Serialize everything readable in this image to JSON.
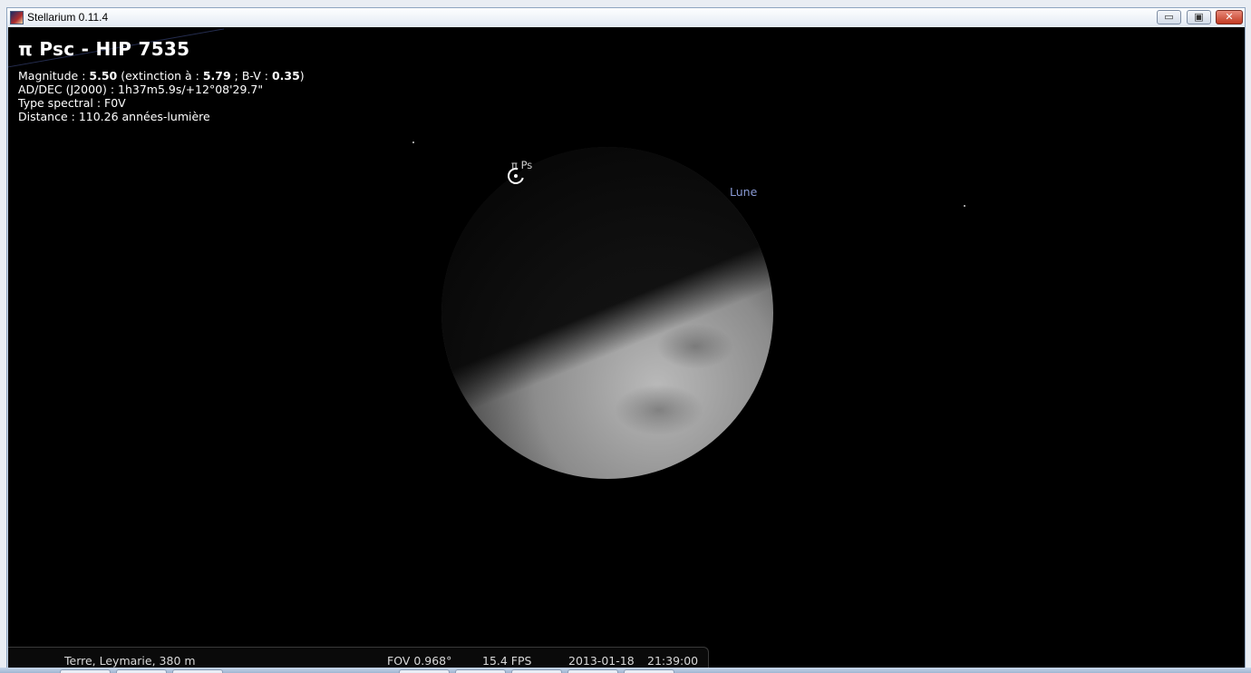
{
  "window": {
    "title": "Stellarium 0.11.4",
    "controls": {
      "minimize": "▭",
      "maximize": "▣",
      "close": "✕"
    }
  },
  "info": {
    "title": "π Psc - HIP 7535",
    "magnitude_label": "Magnitude : ",
    "magnitude": "5.50",
    "extinction_label": " (extinction à  : ",
    "extinction": "5.79",
    "bv_label": " ; B-V : ",
    "bv": "0.35",
    "bv_close": ")",
    "radec": "AD/DEC (J2000) : 1h37m5.9s/+12°08'29.7\"",
    "spectral": "Type spectral : F0V",
    "distance": "Distance : 110.26 années-lumière"
  },
  "sky": {
    "moon_label": "Lune",
    "star_label": "π Ps"
  },
  "status": {
    "location": "Terre, Leymarie, 380 m",
    "fov": "FOV 0.968°",
    "fps": "15.4 FPS",
    "date": "2013-01-18",
    "time": "21:39:00"
  },
  "colors": {
    "sky": "#000000",
    "moon_label": "#8a9bd6",
    "status_text": "#d8d8d8"
  },
  "icons": [
    "app-icon",
    "minimize-icon",
    "maximize-icon",
    "close-icon",
    "target-reticle-icon"
  ]
}
